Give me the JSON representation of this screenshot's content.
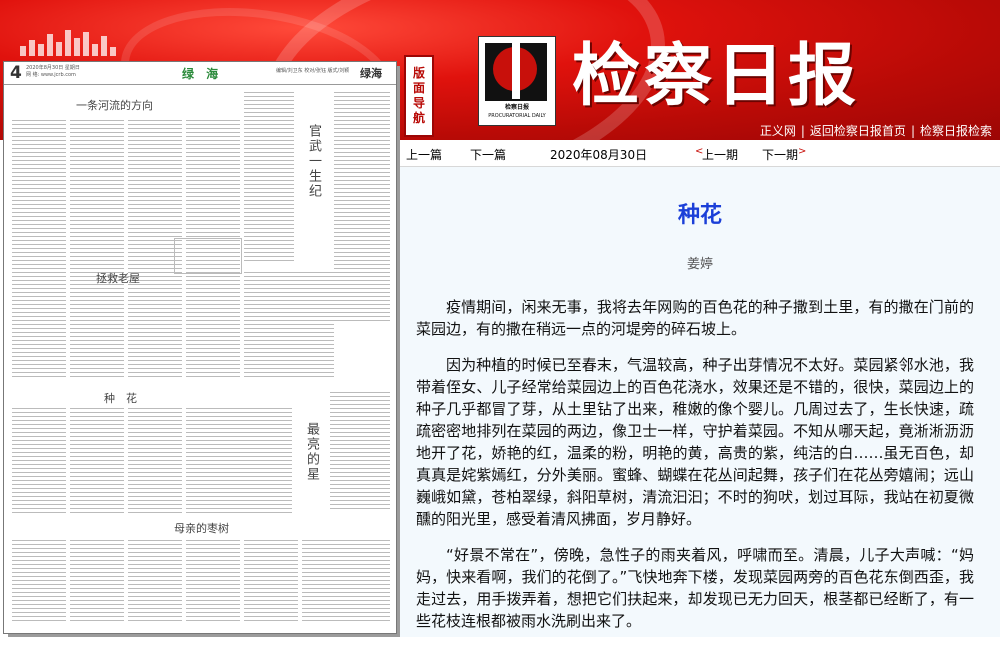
{
  "header": {
    "nav_tag": [
      "版",
      "面",
      "导",
      "航"
    ],
    "logo_caption": "检察日报",
    "logo_subcaption": "PROCURATORIAL DAILY",
    "paper_title": "检察日报",
    "links": [
      "正义网",
      "返回检察日报首页",
      "检察日报检索"
    ]
  },
  "preview": {
    "page_number": "4",
    "meta": "2020年8月30日 星期日",
    "meta2": "网 络: www.jcrb.com",
    "section": "绿 海",
    "right_meta": "编辑/刘卫东 校对/张钰 版式/刘颖",
    "small_title": "绿海",
    "headlines": {
      "river": "一条河流的方向",
      "old_house": "拯救老屋",
      "flower": "种　花",
      "date_tree": "母亲的枣树",
      "prosecutor": "官武一生纪",
      "brightest_star": "最亮的星"
    }
  },
  "toolbar": {
    "prev_article": "上一篇",
    "next_article": "下一篇",
    "date": "2020年08月30日",
    "prev_issue": "上一期",
    "next_issue": "下一期"
  },
  "article": {
    "title": "种花",
    "author": "姜婷",
    "paragraphs": [
      "疫情期间，闲来无事，我将去年网购的百色花的种子撒到土里，有的撒在门前的菜园边，有的撒在稍远一点的河堤旁的碎石坡上。",
      "因为种植的时候已至春末，气温较高，种子出芽情况不太好。菜园紧邻水池，我带着侄女、儿子经常给菜园边上的百色花浇水，效果还是不错的，很快，菜园边上的种子几乎都冒了芽，从土里钻了出来，稚嫩的像个婴儿。几周过去了，生长快速，疏疏密密地排列在菜园的两边，像卫士一样，守护着菜园。不知从哪天起，竟淅淅沥沥地开了花，娇艳的红，温柔的粉，明艳的黄，高贵的紫，纯洁的白……虽无百色，却真真是姹紫嫣红，分外美丽。蜜蜂、蝴蝶在花丛间起舞，孩子们在花丛旁嬉闹；远山巍峨如黛，苍柏翠绿，斜阳草树，清流汩汩；不时的狗吠，划过耳际，我站在初夏微醺的阳光里，感受着清风拂面，岁月静好。",
      "“好景不常在”，傍晚，急性子的雨夹着风，呼啸而至。清晨，儿子大声喊：“妈妈，快来看啊，我们的花倒了。”飞快地奔下楼，发现菜园两旁的百色花东倒西歪，我走过去，用手拨弄着，想把它们扶起来，却发现已无力回天，根茎都已经断了，有一些花枝连根都被雨水洗刷出来了。"
    ]
  },
  "colors": {
    "banner_red": "#c8100b",
    "title_blue": "#1b3fd8",
    "section_green": "#2a8a3a",
    "article_bg": "#f3f9fd"
  }
}
